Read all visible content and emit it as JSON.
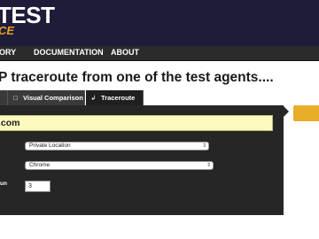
{
  "header": {
    "logo_main": "TEST",
    "logo_sub": "CE"
  },
  "nav": {
    "items": [
      {
        "label": "ORY"
      },
      {
        "label": "DOCUMENTATION"
      },
      {
        "label": "ABOUT"
      }
    ]
  },
  "main": {
    "headline": "P traceroute from one of the test agents...."
  },
  "tabs": [
    {
      "label": "",
      "icon": "document-icon"
    },
    {
      "label": "Visual Comparison",
      "icon": "image-icon"
    },
    {
      "label": "Traceroute",
      "icon": "traceroute-icon"
    }
  ],
  "form": {
    "url_value": ".com",
    "location_value": "Private Location",
    "browser_value": "Chrome",
    "runs_label": "un",
    "runs_value": "3"
  },
  "colors": {
    "accent": "#e8ae2a",
    "header_bg": "#1e1c38",
    "url_bg": "#fbfbbf"
  }
}
